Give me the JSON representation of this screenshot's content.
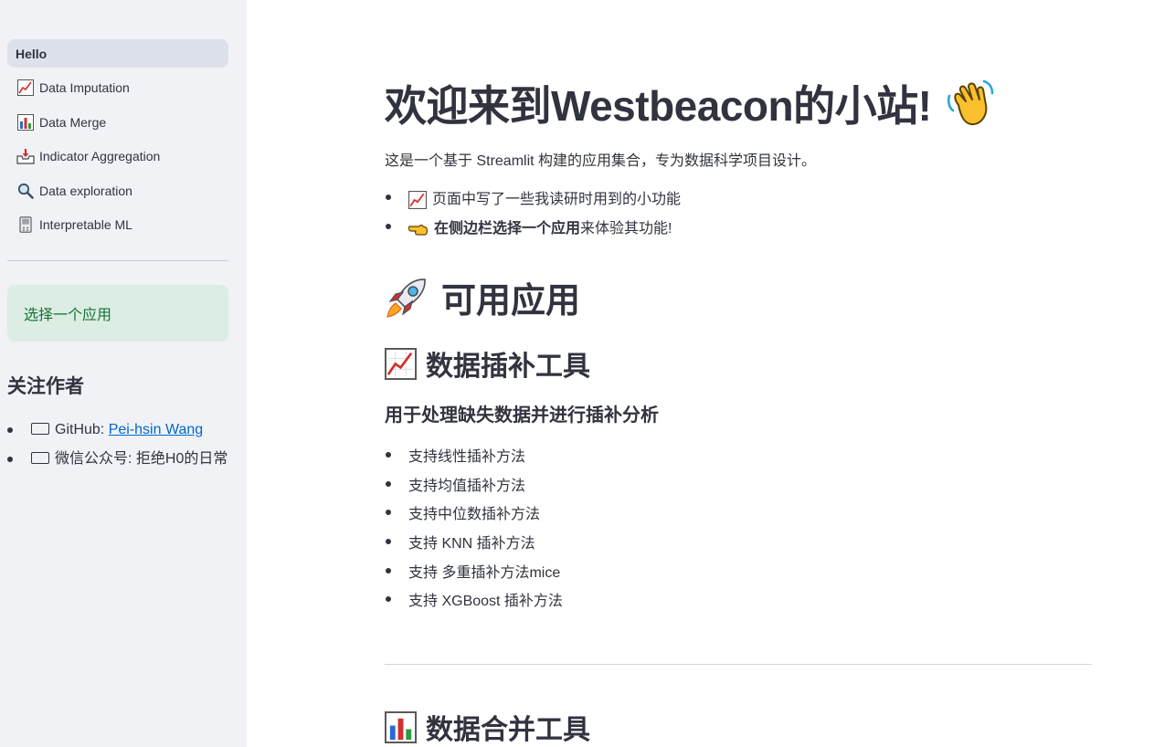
{
  "sidebar": {
    "nav": [
      {
        "label": "Hello",
        "icon": "none",
        "active": true
      },
      {
        "label": "Data Imputation",
        "icon": "chart-increasing-icon"
      },
      {
        "label": "Data Merge",
        "icon": "bar-chart-icon"
      },
      {
        "label": "Indicator Aggregation",
        "icon": "inbox-tray-icon"
      },
      {
        "label": "Data exploration",
        "icon": "magnifier-icon"
      },
      {
        "label": "Interpretable ML",
        "icon": "pager-icon"
      }
    ],
    "success_box": "选择一个应用",
    "follow_title": "关注作者",
    "follow": [
      {
        "prefix": "GitHub: ",
        "link": "Pei-hsin Wang"
      },
      {
        "text": "微信公众号: 拒绝H0的日常"
      }
    ]
  },
  "main": {
    "title": "欢迎来到Westbeacon的小站!",
    "intro": "这是一个基于 Streamlit 构建的应用集合，专为数据科学项目设计。",
    "bullets": [
      {
        "text": "页面中写了一些我读研时用到的小功能"
      },
      {
        "bold": "在侧边栏选择一个应用",
        "text": " 来体验其功能!"
      }
    ],
    "apps_heading": "可用应用",
    "imputation": {
      "heading": "数据插补工具",
      "subheading": "用于处理缺失数据并进行插补分析",
      "features": [
        "支持线性插补方法",
        "支持均值插补方法",
        "支持中位数插补方法",
        "支持 KNN 插补方法",
        "支持 多重插补方法mice",
        "支持 XGBoost 插补方法"
      ]
    },
    "merge": {
      "heading": "数据合并工具"
    }
  },
  "colors": {
    "sidebar_bg": "#f0f2f6",
    "active_nav_bg": "#dde1ea",
    "success_bg": "#dcede4",
    "success_text": "#177233",
    "link": "#0068c9",
    "text": "#31333f"
  }
}
